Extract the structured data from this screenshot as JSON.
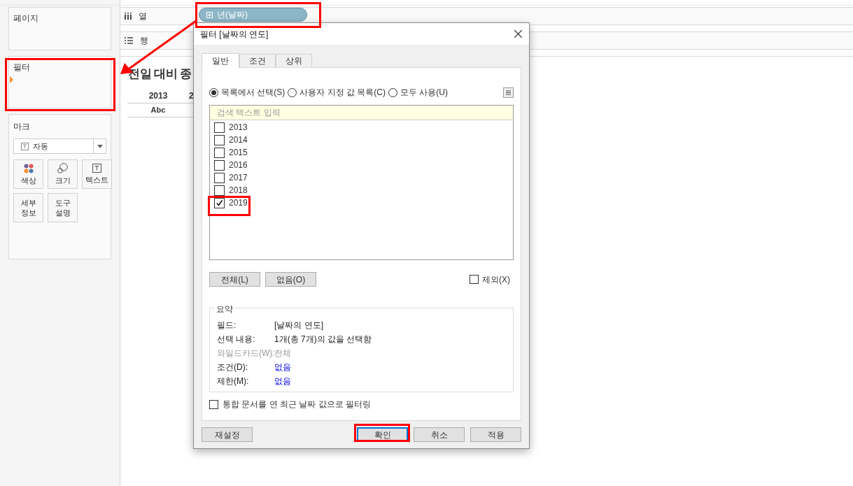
{
  "sidebar": {
    "pages_title": "페이지",
    "filters_title": "필터",
    "marks": {
      "title": "마크",
      "type_dropdown": "자동",
      "buttons": [
        {
          "label": "색상",
          "kind": "color"
        },
        {
          "label": "크기",
          "kind": "size"
        },
        {
          "label": "텍스트",
          "kind": "text"
        },
        {
          "label": "세부 정보",
          "kind": "plain"
        },
        {
          "label": "도구 설명",
          "kind": "plain"
        }
      ]
    }
  },
  "shelves": {
    "columns": {
      "label": "열",
      "pill": "년(날짜)"
    },
    "rows": {
      "label": "행"
    }
  },
  "view": {
    "title": "전일 대비 종",
    "headers": [
      "2013",
      "2"
    ],
    "cell": "Abc"
  },
  "dialog": {
    "title": "필터 [날짜의 연도]",
    "tabs": [
      {
        "label": "일반",
        "selected": true
      },
      {
        "label": "조건",
        "selected": false
      },
      {
        "label": "상위",
        "selected": false
      }
    ],
    "modes": [
      {
        "label": "목록에서 선택(S)",
        "selected": true
      },
      {
        "label": "사용자 지정 값 목록(C)",
        "selected": false
      },
      {
        "label": "모두 사용(U)",
        "selected": false
      }
    ],
    "search_placeholder": "검색 텍스트 입력",
    "items": [
      {
        "label": "2013",
        "checked": false
      },
      {
        "label": "2014",
        "checked": false
      },
      {
        "label": "2015",
        "checked": false
      },
      {
        "label": "2016",
        "checked": false
      },
      {
        "label": "2017",
        "checked": false
      },
      {
        "label": "2018",
        "checked": false
      },
      {
        "label": "2019",
        "checked": true
      }
    ],
    "select_buttons": [
      "전체(L)",
      "없음(O)"
    ],
    "exclude": {
      "label": "제외(X)",
      "checked": false
    },
    "summary": {
      "title": "요약",
      "rows": [
        {
          "label": "필드:",
          "value": "[날짜의 연도]",
          "kind": "plain"
        },
        {
          "label": "선택 내용:",
          "value": "1개(총 7개)의 값을 선택함",
          "kind": "plain"
        },
        {
          "label": "와일드카드(W):",
          "value": "전체",
          "kind": "disabled"
        },
        {
          "label": "조건(D):",
          "value": "없음",
          "kind": "link"
        },
        {
          "label": "제한(M):",
          "value": "없음",
          "kind": "link"
        }
      ]
    },
    "latest_date": {
      "label": "통합 문서를 연 최근 날짜 값으로 필터링",
      "checked": false
    },
    "reset_button": "재설정",
    "footer_buttons": [
      {
        "label": "확인",
        "default": true
      },
      {
        "label": "취소",
        "default": false
      },
      {
        "label": "적용",
        "default": false
      }
    ]
  }
}
